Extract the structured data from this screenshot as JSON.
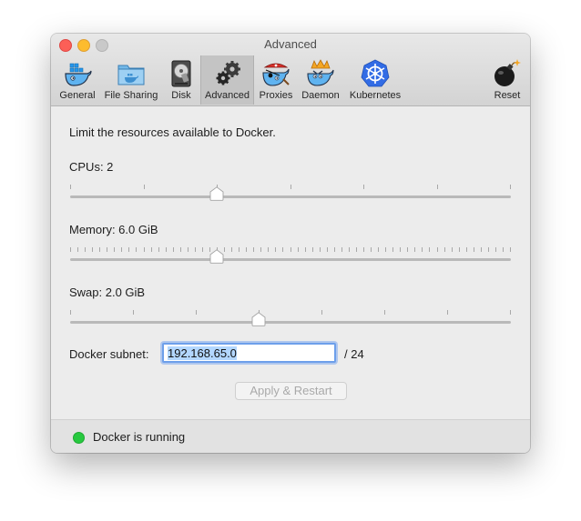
{
  "window": {
    "title": "Advanced"
  },
  "toolbar": {
    "tabs": [
      {
        "id": "general",
        "label": "General",
        "icon": "docker-whale-icon"
      },
      {
        "id": "file-sharing",
        "label": "File Sharing",
        "icon": "folder-icon"
      },
      {
        "id": "disk",
        "label": "Disk",
        "icon": "disk-drive-icon"
      },
      {
        "id": "advanced",
        "label": "Advanced",
        "icon": "gears-icon",
        "active": true
      },
      {
        "id": "proxies",
        "label": "Proxies",
        "icon": "pirate-whale-icon"
      },
      {
        "id": "daemon",
        "label": "Daemon",
        "icon": "daemon-whale-icon"
      },
      {
        "id": "kubernetes",
        "label": "Kubernetes",
        "icon": "kubernetes-wheel-icon"
      },
      {
        "id": "reset",
        "label": "Reset",
        "icon": "bomb-icon"
      }
    ]
  },
  "content": {
    "intro": "Limit the resources available to Docker.",
    "cpus": {
      "label": "CPUs: 2",
      "value": 2,
      "min": 1,
      "max": 4
    },
    "memory": {
      "label": "Memory: 6.0 GiB",
      "value_gib": 6.0,
      "min_gib": 1.0,
      "max_gib": 16.0
    },
    "swap": {
      "label": "Swap: 2.0 GiB",
      "value_gib": 2.0,
      "min_gib": 0.5,
      "max_gib": 4.0
    },
    "subnet": {
      "label": "Docker subnet:",
      "value": "192.168.65.0",
      "suffix": "/ 24"
    },
    "apply_label": "Apply & Restart"
  },
  "status": {
    "text": "Docker is running",
    "color": "#27c93f"
  },
  "colors": {
    "accent": "#6d9fea",
    "selection": "#b3d7ff"
  }
}
